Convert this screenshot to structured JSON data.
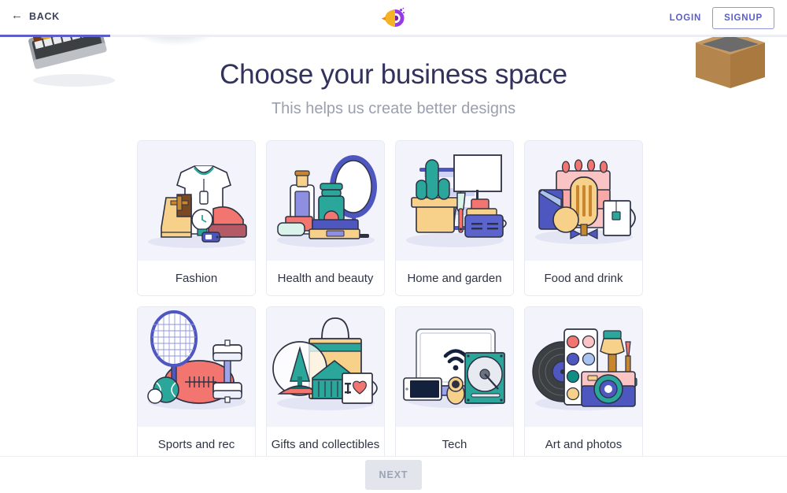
{
  "header": {
    "back_label": "BACK",
    "back_icon": "arrow-left-icon",
    "logo_icon": "brand-bird-logo",
    "login_label": "LOGIN",
    "signup_label": "SIGNUP",
    "accent_color": "#5a5fc7"
  },
  "progress": {
    "percent": 14,
    "fill_color": "#5b5fc7",
    "track_color": "#eceef3"
  },
  "main": {
    "title": "Choose your business space",
    "subtitle": "This helps us create better designs"
  },
  "cards": [
    {
      "label": "Fashion",
      "art": "fashion-illustration"
    },
    {
      "label": "Health and beauty",
      "art": "health-beauty-illustration"
    },
    {
      "label": "Home and garden",
      "art": "home-garden-illustration"
    },
    {
      "label": "Food and drink",
      "art": "food-drink-illustration"
    },
    {
      "label": "Sports and rec",
      "art": "sports-rec-illustration"
    },
    {
      "label": "Gifts and collectibles",
      "art": "gifts-collectibles-illustration"
    },
    {
      "label": "Tech",
      "art": "tech-illustration"
    },
    {
      "label": "Art and photos",
      "art": "art-photos-illustration"
    }
  ],
  "footer": {
    "next_label": "NEXT",
    "next_disabled": true
  },
  "decor": {
    "left_photo": "colored-pencils-photo",
    "right_photo": "wooden-box-photo"
  }
}
